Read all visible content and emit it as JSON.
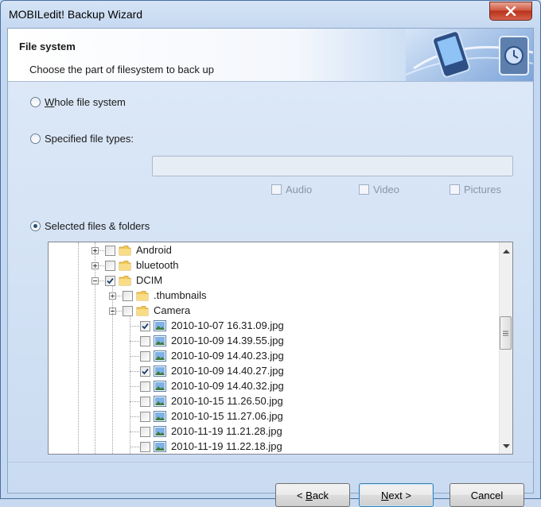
{
  "window": {
    "title": "MOBILedit! Backup Wizard"
  },
  "header": {
    "title": "File system",
    "subtitle": "Choose the part of filesystem to back up"
  },
  "options": {
    "whole": {
      "label": "Whole file system",
      "selected": false
    },
    "specified": {
      "label": "Specified file types:",
      "selected": false,
      "value": ""
    },
    "selected": {
      "label": "Selected files & folders",
      "selected": true
    }
  },
  "file_types": [
    {
      "label": "Audio",
      "checked": false
    },
    {
      "label": "Video",
      "checked": false
    },
    {
      "label": "Pictures",
      "checked": false
    }
  ],
  "tree": {
    "rows": [
      {
        "label": "Android",
        "type": "folder",
        "depth": 0,
        "expander": "plus",
        "checked": false
      },
      {
        "label": "bluetooth",
        "type": "folder",
        "depth": 0,
        "expander": "plus",
        "checked": false
      },
      {
        "label": "DCIM",
        "type": "folder",
        "depth": 0,
        "expander": "minus",
        "checked": true
      },
      {
        "label": ".thumbnails",
        "type": "folder",
        "depth": 1,
        "expander": "plus",
        "checked": false
      },
      {
        "label": "Camera",
        "type": "folder",
        "depth": 1,
        "expander": "minus",
        "checked": false
      },
      {
        "label": "2010-10-07 16.31.09.jpg",
        "type": "image",
        "depth": 2,
        "expander": "none",
        "checked": true
      },
      {
        "label": "2010-10-09 14.39.55.jpg",
        "type": "image",
        "depth": 2,
        "expander": "none",
        "checked": false
      },
      {
        "label": "2010-10-09 14.40.23.jpg",
        "type": "image",
        "depth": 2,
        "expander": "none",
        "checked": false
      },
      {
        "label": "2010-10-09 14.40.27.jpg",
        "type": "image",
        "depth": 2,
        "expander": "none",
        "checked": true
      },
      {
        "label": "2010-10-09 14.40.32.jpg",
        "type": "image",
        "depth": 2,
        "expander": "none",
        "checked": false
      },
      {
        "label": "2010-10-15 11.26.50.jpg",
        "type": "image",
        "depth": 2,
        "expander": "none",
        "checked": false
      },
      {
        "label": "2010-10-15 11.27.06.jpg",
        "type": "image",
        "depth": 2,
        "expander": "none",
        "checked": false
      },
      {
        "label": "2010-11-19 11.21.28.jpg",
        "type": "image",
        "depth": 2,
        "expander": "none",
        "checked": false
      },
      {
        "label": "2010-11-19 11.22.18.jpg",
        "type": "image",
        "depth": 2,
        "expander": "none",
        "checked": false
      }
    ],
    "scroll_position": 0.4
  },
  "buttons": {
    "back": "< Back",
    "next": "Next >",
    "cancel": "Cancel"
  },
  "colors": {
    "folder": "#f2c85a",
    "accent": "#2b4f7a",
    "close": "#c7432c"
  }
}
